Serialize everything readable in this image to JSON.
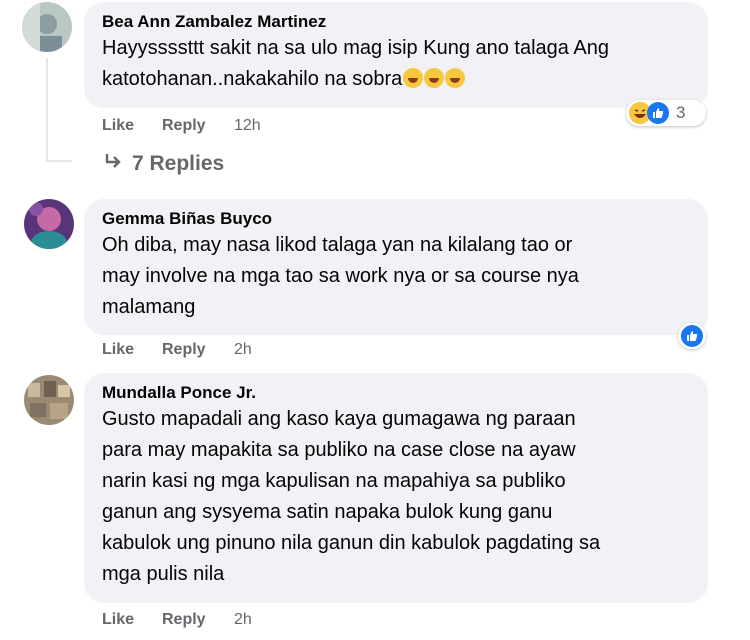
{
  "comments": [
    {
      "author": "Bea Ann Zambalez Martinez",
      "text": "Hayyssssttt sakit na sa ulo mag isip Kung ano talaga Ang\nkatotohanan..nakakahilo na sobra",
      "emoji": "rolling-laughing-emoji x3",
      "like_label": "Like",
      "reply_label": "Reply",
      "time": "12h",
      "reaction_icons": [
        "haha-icon",
        "like-icon"
      ],
      "reaction_count": "3",
      "replies_label": "7 Replies",
      "avatar_color": "#a7b9b5"
    },
    {
      "author": "Gemma Biñas Buyco",
      "text": "Oh diba, may nasa likod talaga yan na kilalang tao or\nmay involve na mga tao sa work nya or sa course nya\nmalamang",
      "like_label": "Like",
      "reply_label": "Reply",
      "time": "2h",
      "reaction_icons": [
        "like-icon"
      ],
      "avatar_color": "#6d3e8c"
    },
    {
      "author": "Mundalla Ponce Jr.",
      "text": "Gusto mapadali ang kaso kaya gumagawa ng paraan\npara may mapakita sa publiko na case close na ayaw\nnarin kasi ng mga kapulisan na mapahiya sa publiko\nganun ang sysyema satin napaka bulok kung ganu\nkabulok ung pinuno nila ganun din kabulok pagdating sa\nmga pulis nila",
      "like_label": "Like",
      "reply_label": "Reply",
      "time": "2h",
      "avatar_color": "#a08f76"
    }
  ],
  "colors": {
    "bubble": "#f0f2f5",
    "meta_text": "#65676b",
    "like_blue": "#1877f2",
    "haha_yellow": "#f7c740"
  }
}
